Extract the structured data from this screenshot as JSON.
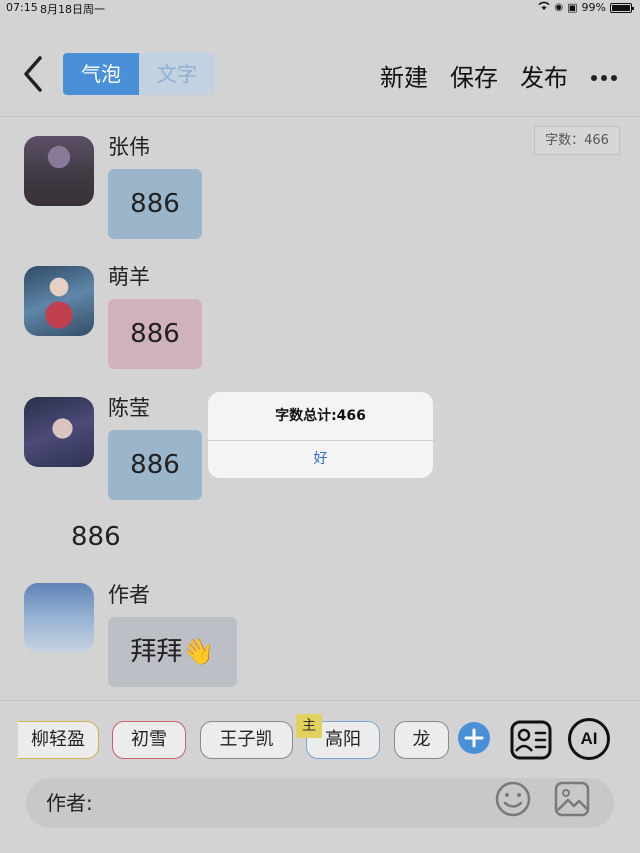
{
  "status_bar": {
    "time": "07:15",
    "date": "8月18日周一",
    "battery": "99%"
  },
  "header": {
    "tabs": [
      "气泡",
      "文字"
    ],
    "active_tab": "气泡",
    "actions": [
      "新建",
      "保存",
      "发布"
    ]
  },
  "word_count_label": "字数：466",
  "messages": [
    {
      "sender": "张伟",
      "text": "886",
      "bubble_color": "#9bb6cb"
    },
    {
      "sender": "萌羊",
      "text": "886",
      "bubble_color": "#d0b2ba"
    },
    {
      "sender": "陈莹",
      "text": "886",
      "bubble_color": "#9bb6cb"
    }
  ],
  "narration": "886",
  "author_message": {
    "sender": "作者",
    "text": "拜拜👋"
  },
  "alert": {
    "title": "字数总计:466",
    "button": "好"
  },
  "characters": [
    "柳轻盈",
    "初雪",
    "王子凯",
    "高阳",
    "龙"
  ],
  "master_tag": "主",
  "ai_label": "AI",
  "input": {
    "speaker_label": "作者:"
  },
  "colors": {
    "accent": "#4a90d9",
    "alert_button": "#2a6fd0"
  },
  "icons": [
    "back-chevron-icon",
    "more-dots-icon",
    "plus-icon",
    "character-card-icon",
    "emoji-icon",
    "image-icon",
    "wifi-icon",
    "vpn-icon",
    "battery-icon"
  ]
}
